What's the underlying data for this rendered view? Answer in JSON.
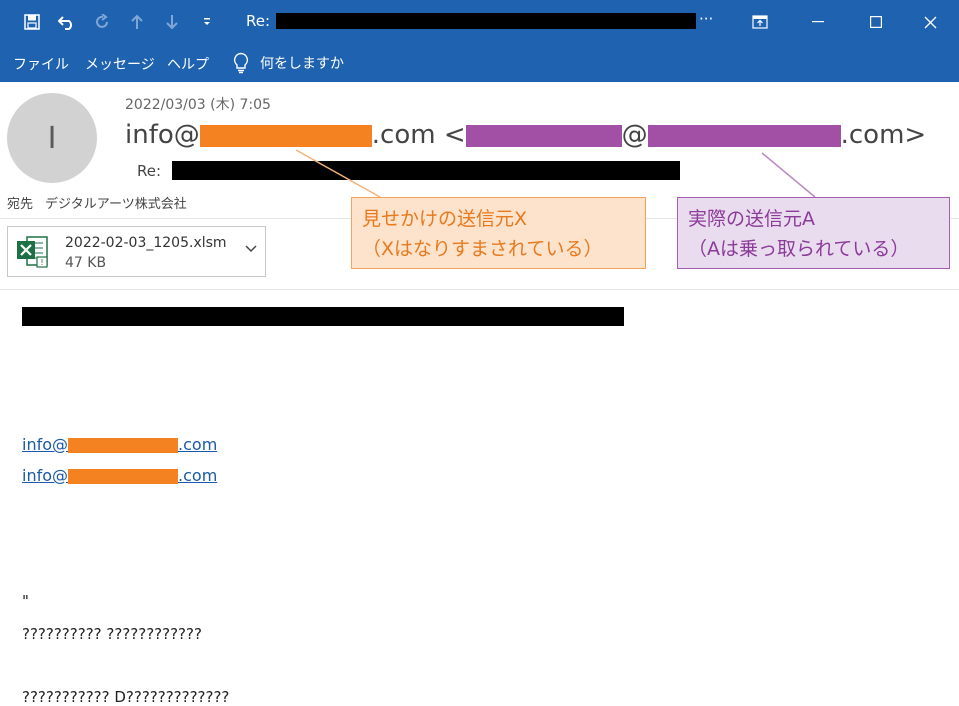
{
  "window": {
    "title_prefix": "Re:",
    "title_suffix": "···"
  },
  "menu": {
    "file": "ファイル",
    "message": "メッセージ",
    "help": "ヘルプ",
    "tellme": "何をしますか"
  },
  "email": {
    "avatar_initial": "I",
    "date": "2022/03/03 (木) 7:05",
    "from_prefix": "info@",
    "from_domain_suffix": ".com",
    "from_open": "<",
    "from_at": "@",
    "from_close_suffix": ".com>",
    "subject_label": "Re:",
    "to_label": "宛先",
    "to_value": "デジタルアーツ株式会社"
  },
  "attachment": {
    "name": "2022-02-03_1205.xlsm",
    "size": "47 KB",
    "icon": "excel-icon"
  },
  "body": {
    "link1_prefix": "info@",
    "link1_suffix": ".com",
    "link2_prefix": "info@",
    "link2_suffix": ".com",
    "quote": "\"",
    "line1": "?????????? ????????????",
    "line2": "??????????? D?????????????"
  },
  "annotations": {
    "fake_sender_line1": "見せかけの送信元X",
    "fake_sender_line2": "（Xはなりすまされている）",
    "real_sender_line1": "実際の送信元A",
    "real_sender_line2": "（Aは乗っ取られている）"
  },
  "colors": {
    "titlebar": "#1f63b0",
    "redact_orange": "#f58220",
    "redact_purple": "#a24fa6",
    "callout_orange_bg": "#fde2cc",
    "callout_purple_bg": "#eadcef"
  }
}
